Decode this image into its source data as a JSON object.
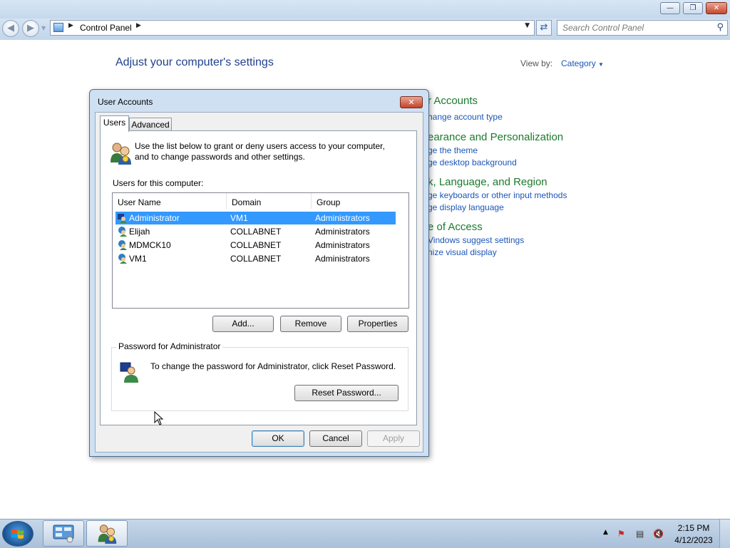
{
  "window": {
    "controls": {
      "minimize": "—",
      "maximize": "❐",
      "close": "✕"
    }
  },
  "nav": {
    "breadcrumb": "Control Panel",
    "search_placeholder": "Search Control Panel"
  },
  "control_panel": {
    "heading": "Adjust your computer's settings",
    "view_by_label": "View by:",
    "view_by_value": "Category",
    "categories": [
      {
        "title": "r Accounts",
        "links": [
          "hange account type"
        ]
      },
      {
        "title": "earance and Personalization",
        "links": [
          "ge the theme",
          "ge desktop background"
        ]
      },
      {
        "title": "k, Language, and Region",
        "links": [
          "ge keyboards or other input methods",
          "ge display language"
        ]
      },
      {
        "title": "e of Access",
        "links": [
          "Vindows suggest settings",
          "nize visual display"
        ]
      }
    ]
  },
  "dialog": {
    "title": "User Accounts",
    "tabs": [
      "Users",
      "Advanced"
    ],
    "intro": "Use the list below to grant or deny users access to your computer, and to change passwords and other settings.",
    "users_label": "Users for this computer:",
    "columns": [
      "User Name",
      "Domain",
      "Group"
    ],
    "users": [
      {
        "name": "Administrator",
        "domain": "VM1",
        "group": "Administrators"
      },
      {
        "name": "Elijah",
        "domain": "COLLABNET",
        "group": "Administrators"
      },
      {
        "name": "MDMCK10",
        "domain": "COLLABNET",
        "group": "Administrators"
      },
      {
        "name": "VM1",
        "domain": "COLLABNET",
        "group": "Administrators"
      }
    ],
    "buttons": {
      "add": "Add...",
      "remove": "Remove",
      "properties": "Properties"
    },
    "password_group_label": "Password for Administrator",
    "password_text": "To change the password for Administrator, click Reset Password.",
    "reset_password": "Reset Password...",
    "ok": "OK",
    "cancel": "Cancel",
    "apply": "Apply"
  },
  "taskbar": {
    "time": "2:15 PM",
    "date": "4/12/2023"
  }
}
